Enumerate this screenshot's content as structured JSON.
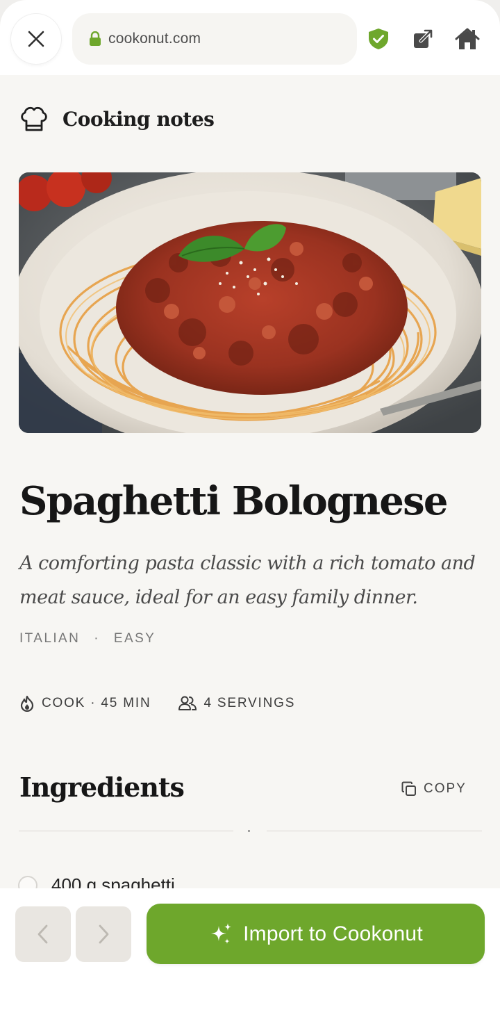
{
  "browser": {
    "url": "cookonut.com",
    "icons": [
      "close-icon",
      "lock-icon",
      "shield-check-icon",
      "open-external-icon",
      "home-icon"
    ],
    "shield_color": "#6ea72c"
  },
  "header": {
    "section_label": "Cooking notes",
    "icon": "chef-hat-icon"
  },
  "recipe": {
    "image_alt": "Spaghetti with bolognese sauce, basil and parmesan",
    "title": "Spaghetti Bolognese",
    "description": "A comforting pasta classic with a rich tomato and meat sauce, ideal for an easy family dinner.",
    "tags": [
      "ITALIAN",
      "EASY"
    ],
    "tag_separator": "·",
    "cook_time": "COOK · 45 MIN",
    "servings": "4 SERVINGS"
  },
  "ingredients": {
    "heading": "Ingredients",
    "copy_label": "COPY",
    "items": [
      "400 g spaghetti"
    ]
  },
  "footer": {
    "import_label": "Import to Cookonut",
    "accent": "#6ea72c",
    "prev_icon": "chevron-left-icon",
    "next_icon": "chevron-right-icon",
    "import_icon": "sparkles-icon"
  }
}
